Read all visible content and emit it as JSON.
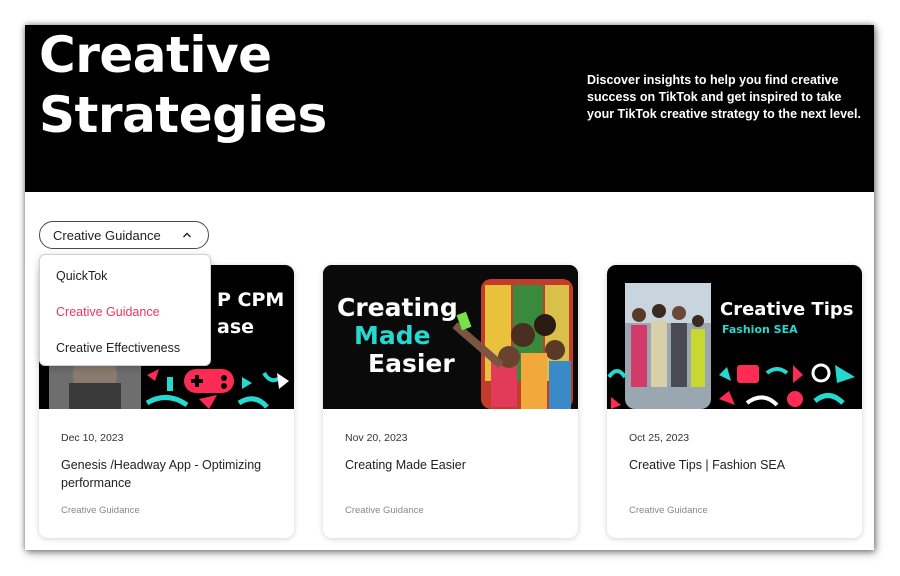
{
  "hero": {
    "title_line1": "Creative",
    "title_line2": "Strategies",
    "description": "Discover insights to help you find creative success on TikTok and get inspired to take your TikTok creative strategy to the next level."
  },
  "filter": {
    "selected": "Creative Guidance",
    "options": [
      "QuickTok",
      "Creative Guidance",
      "Creative Effectiveness"
    ]
  },
  "cards": [
    {
      "thumb_text_line1": "P CPM",
      "thumb_text_line2": "ase",
      "date": "Dec 10, 2023",
      "title": "Genesis /Headway App - Optimizing performance",
      "tag": "Creative Guidance"
    },
    {
      "thumb_line1": "Creating",
      "thumb_line2": "Made",
      "thumb_line3": "Easier",
      "date": "Nov 20, 2023",
      "title": "Creating Made Easier",
      "tag": "Creative Guidance"
    },
    {
      "thumb_line1": "Creative Tips",
      "thumb_line2": "Fashion SEA",
      "date": "Oct 25, 2023",
      "title": "Creative Tips | Fashion SEA",
      "tag": "Creative Guidance"
    }
  ],
  "colors": {
    "accent_pink": "#e8375f",
    "accent_cyan": "#25d9d0",
    "accent_red": "#fe2c55",
    "hero_bg": "#000000"
  }
}
